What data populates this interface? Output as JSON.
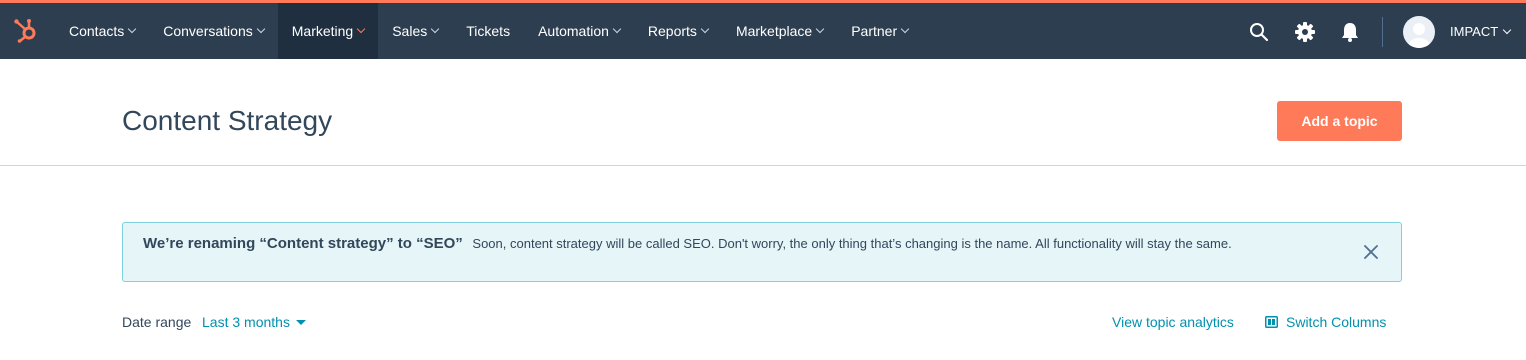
{
  "colors": {
    "navbar_bg": "#2d3e50",
    "accent": "#ff7a59",
    "link": "#0091ae",
    "alert_bg": "#e5f5f8",
    "alert_border": "#7fd1de",
    "text": "#33475b"
  },
  "nav": {
    "logo_icon": "sprocket-icon",
    "items": [
      {
        "label": "Contacts",
        "has_dropdown": true
      },
      {
        "label": "Conversations",
        "has_dropdown": true
      },
      {
        "label": "Marketing",
        "has_dropdown": true,
        "active": true
      },
      {
        "label": "Sales",
        "has_dropdown": true
      },
      {
        "label": "Tickets",
        "has_dropdown": false
      },
      {
        "label": "Automation",
        "has_dropdown": true
      },
      {
        "label": "Reports",
        "has_dropdown": true
      },
      {
        "label": "Marketplace",
        "has_dropdown": true
      },
      {
        "label": "Partner",
        "has_dropdown": true
      }
    ],
    "tools": [
      "search-icon",
      "gear-icon",
      "bell-icon"
    ],
    "account_name": "IMPACT"
  },
  "header": {
    "title": "Content Strategy",
    "add_topic_label": "Add a topic"
  },
  "alert": {
    "title": "We’re renaming “Content strategy” to “SEO”",
    "body": "Soon, content strategy will be called SEO. Don't worry, the only thing that’s changing is the name. All functionality will stay the same."
  },
  "filters": {
    "date_range_label": "Date range",
    "date_range_value": "Last 3 months",
    "view_analytics_label": "View topic analytics",
    "switch_columns_label": "Switch Columns"
  }
}
